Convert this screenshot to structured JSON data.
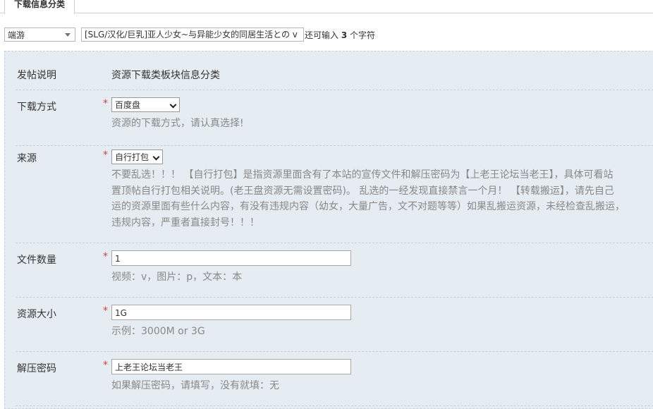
{
  "tab": {
    "label": "下载信息分类"
  },
  "title_row": {
    "type_value": "端游",
    "subject_value": "[SLG/汉化/巨乳]亚人少女~与异能少女的同居生活との v",
    "remain_prefix": "还可输入",
    "remain_count": "3",
    "remain_suffix": "个字符"
  },
  "form": {
    "intro": {
      "label": "发帖说明",
      "text": "资源下载类板块信息分类"
    },
    "download_method": {
      "label": "下载方式",
      "required": "*",
      "value": "百度盘",
      "desc": "资源的下载方式，请认真选择!"
    },
    "source": {
      "label": "来源",
      "required": "*",
      "value": "自行打包",
      "desc": [
        "不要乱选！！！ 【自行打包】是指资源里面含有了本站的宣传文件和解压密码为【上老王论坛当老王】，具体可看站",
        "置顶帖自行打包相关说明。(老王盘资源无需设置密码)。 乱选的一经发现直接禁言一个月！ 【转载搬运】，请先自己",
        "运的资源里面有些什么内容，有没有违规内容（幼女，大量广告，文不对题等等）如果乱搬运资源，未经检查乱搬运，",
        "违规内容，严重者直接封号！！！"
      ]
    },
    "file_count": {
      "label": "文件数量",
      "required": "*",
      "value": "1",
      "desc": "视频：v，图片：p，文本：本"
    },
    "size": {
      "label": "资源大小",
      "required": "*",
      "value": "1G",
      "desc": "示例：3000M or 3G"
    },
    "password": {
      "label": "解压密码",
      "required": "*",
      "value": "上老王论坛当老王",
      "desc": "如果解压密码，请填写，没有就填：无"
    }
  }
}
